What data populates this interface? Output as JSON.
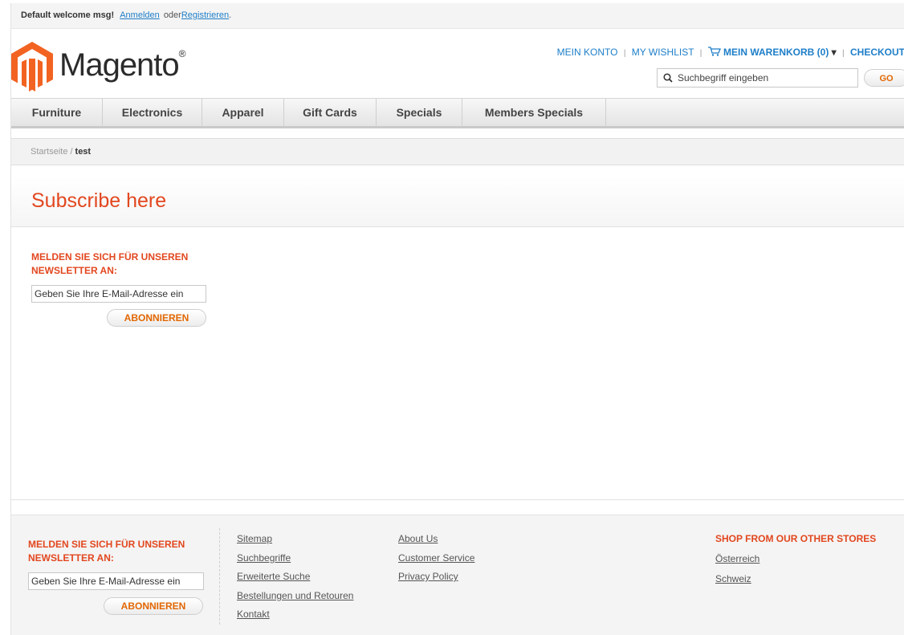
{
  "header": {
    "welcome_msg": "Default welcome msg!",
    "login_link": "Anmelden",
    "or_text": "oder",
    "register_link": "Registrieren",
    "period": ".",
    "logo_text": "Magento",
    "logo_mark": "®",
    "top_links": {
      "account": "MEIN KONTO",
      "wishlist": "MY WISHLIST",
      "cart": "MEIN WARENKORB (0)",
      "cart_caret": "▾",
      "checkout": "CHECKOUT",
      "separator": "|"
    },
    "search": {
      "placeholder": "Suchbegriff eingeben",
      "button": "GO"
    }
  },
  "nav": {
    "items": [
      "Furniture",
      "Electronics",
      "Apparel",
      "Gift Cards",
      "Specials",
      "Members Specials"
    ]
  },
  "breadcrumb": {
    "home": "Startseite",
    "separator": "/",
    "current": "test"
  },
  "page": {
    "title": "Subscribe here"
  },
  "newsletter": {
    "title_line1": "MELDEN SIE SICH FÜR UNSEREN",
    "title_line2": "NEWSLETTER AN:",
    "placeholder": "Geben Sie Ihre E-Mail-Adresse ein",
    "button": "ABONNIEREN"
  },
  "footer": {
    "newsletter": {
      "title_line1": "MELDEN SIE SICH FÜR UNSEREN",
      "title_line2": "NEWSLETTER AN:",
      "placeholder": "Geben Sie Ihre E-Mail-Adresse ein",
      "button": "ABONNIEREN"
    },
    "links_col1": [
      "Sitemap",
      "Suchbegriffe",
      "Erweiterte Suche",
      "Bestellungen und Retouren",
      "Kontakt"
    ],
    "links_col2": [
      "About Us",
      "Customer Service",
      "Privacy Policy"
    ],
    "stores": {
      "title": "SHOP FROM OUR OTHER STORES",
      "items": [
        "Österreich",
        "Schweiz"
      ]
    }
  },
  "colors": {
    "accent": "#e2471f",
    "link": "#1e7ec8",
    "logo": "#f26322"
  }
}
